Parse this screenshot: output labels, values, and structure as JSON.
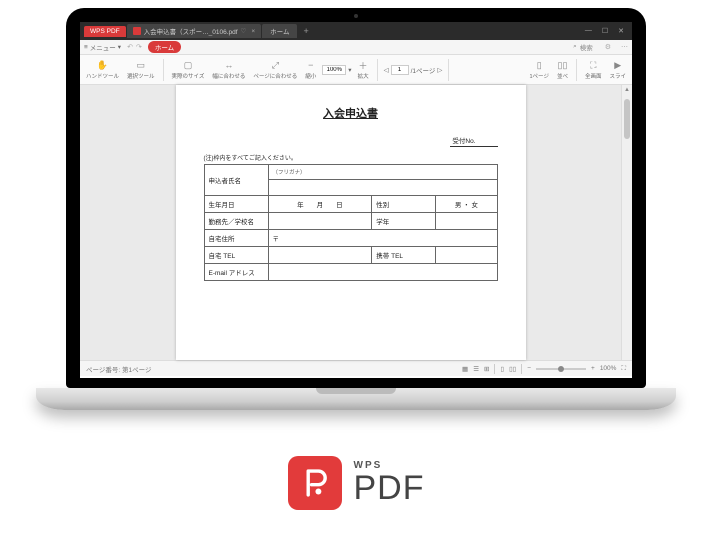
{
  "titlebar": {
    "appName": "WPS PDF",
    "fileName": "入会申込書（スポー…_0106.pdf",
    "homeTab": "ホーム"
  },
  "menubar": {
    "menu": "メニュー",
    "home": "ホーム",
    "searchPlaceholder": "検索"
  },
  "toolbar": {
    "hand": "ハンドツール",
    "select": "選択ツール",
    "actualSize": "実際のサイズ",
    "fitWidth": "幅に合わせる",
    "fitPage": "ページに合わせる",
    "zoomOut": "縮小",
    "zoomIn": "拡大",
    "zoomValue": "100%",
    "pageValue": "1",
    "pageTotal": "/1ページ",
    "singlePage": "1ページ",
    "facing": "並べ",
    "fullscreen": "全画面",
    "slide": "スライ"
  },
  "doc": {
    "title": "入会申込書",
    "receiptLabel": "受付No.",
    "note": "(注)枠内をすべてご記入ください。",
    "rows": {
      "furigana": "（フリガナ）",
      "name": "申込者氏名",
      "birth": "生年月日",
      "birthFmt": "年　　月　　日",
      "sex": "性別",
      "sexOpts": "男 ・ 女",
      "work": "勤務先／学校名",
      "grade": "学年",
      "address": "自宅住所",
      "postal": "〒",
      "homeTel": "自宅 TEL",
      "mobileTel": "携帯 TEL",
      "email": "E-mail アドレス"
    }
  },
  "statusbar": {
    "pageInfo": "ページ番号: 第1ページ",
    "zoom": "100%"
  },
  "brand": {
    "wps": "WPS",
    "pdf": "PDF"
  }
}
